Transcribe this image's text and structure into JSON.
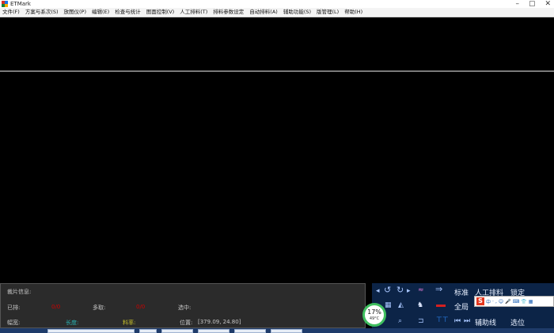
{
  "window": {
    "title": "ETMark",
    "min": "–",
    "max": "▢",
    "close": "✕"
  },
  "menu": [
    "文件(F)",
    "方案与系次(S)",
    "放图仪(P)",
    "编辑(E)",
    "检查与统计",
    "图面控制(V)",
    "人工排料(T)",
    "排料参数设定",
    "自动排料(A)",
    "辅助功能(S)",
    "版管理(L)",
    "帮助(H)"
  ],
  "info": {
    "heading": "裁片信息:",
    "done_label": "已排:",
    "done_value": "0/0",
    "extra_label": "多取:",
    "extra_value": "0/0",
    "selected_label": "选中:",
    "width_label": "幅宽:",
    "length_label": "长度:",
    "rate_label": "料率:",
    "position_label": "位置:",
    "position_value": "[379.09, 24.80]"
  },
  "toolbar": {
    "standard": "标准",
    "manual": "人工排料",
    "lock": "锁定",
    "full": "全局",
    "aux_line": "辅助线",
    "select_pos": "选位",
    "icons": [
      "prev-arrow-icon",
      "rotate-left-icon",
      "rotate-right-icon",
      "next-arrow-icon",
      "rainbow-icon",
      "arrow-right-icon",
      "grid-icon",
      "ruler-icon",
      "cattle-icon",
      "flag-icon",
      "zoom-icon",
      "tag-icon",
      "frame-icon",
      "skip-start-icon",
      "skip-end-icon"
    ]
  },
  "ime": {
    "logo": "S",
    "glyphs": [
      "中",
      "·",
      ",",
      "☺",
      "🎤",
      "⌨",
      "👕",
      "▦"
    ]
  },
  "cpu": {
    "percent": "17%",
    "temp": "49°C"
  }
}
